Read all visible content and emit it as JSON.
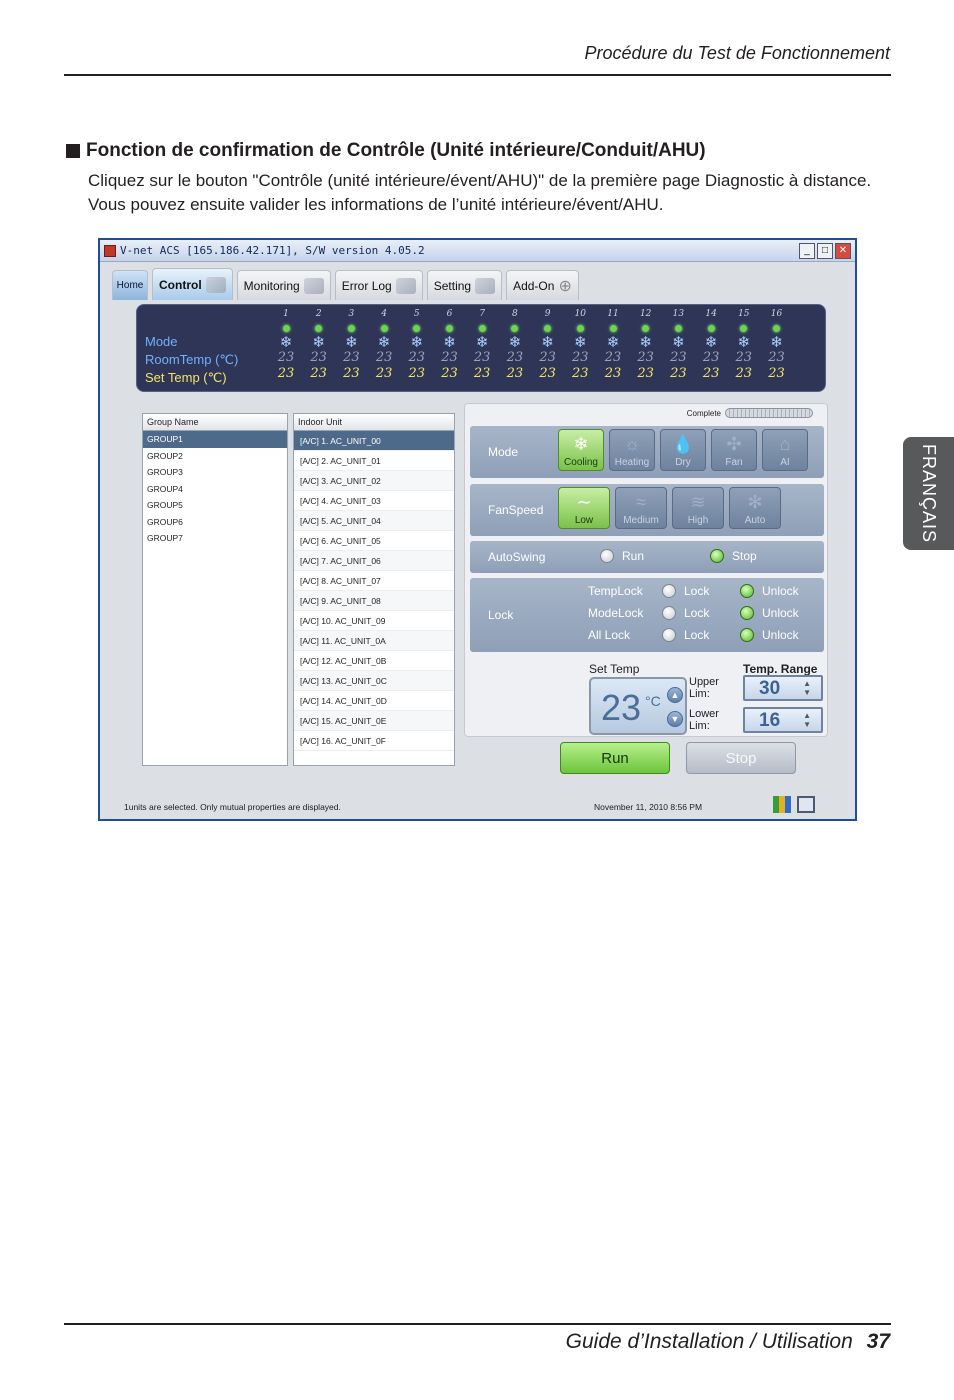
{
  "page": {
    "running_head": "Procédure du Test de Fonctionnement",
    "section_title": "Fonction de confirmation de Contrôle (Unité intérieure/Conduit/AHU)",
    "body_text": "Cliquez sur le bouton \"Contrôle (unité intérieure/évent/AHU)\" de la première page Diagnostic à distance. Vous pouvez ensuite valider les informations de l’unité intérieure/évent/AHU.",
    "side_tab": "FRANÇAIS",
    "footer_title": "Guide d’Installation / Utilisation",
    "page_number": "37"
  },
  "app": {
    "title": "V-net ACS [165.186.42.171],  S/W version 4.05.2",
    "tabs": [
      "Home",
      "Control",
      "Monitoring",
      "Error Log",
      "Setting",
      "Add-On"
    ],
    "status_labels": {
      "mode": "Mode",
      "room_temp": "RoomTemp (℃)",
      "set_temp": "Set Temp   (℃)"
    },
    "units": [
      {
        "n": "1",
        "rt": "23",
        "st": "23"
      },
      {
        "n": "2",
        "rt": "23",
        "st": "23"
      },
      {
        "n": "3",
        "rt": "23",
        "st": "23"
      },
      {
        "n": "4",
        "rt": "23",
        "st": "23"
      },
      {
        "n": "5",
        "rt": "23",
        "st": "23"
      },
      {
        "n": "6",
        "rt": "23",
        "st": "23"
      },
      {
        "n": "7",
        "rt": "23",
        "st": "23"
      },
      {
        "n": "8",
        "rt": "23",
        "st": "23"
      },
      {
        "n": "9",
        "rt": "23",
        "st": "23"
      },
      {
        "n": "10",
        "rt": "23",
        "st": "23"
      },
      {
        "n": "11",
        "rt": "23",
        "st": "23"
      },
      {
        "n": "12",
        "rt": "23",
        "st": "23"
      },
      {
        "n": "13",
        "rt": "23",
        "st": "23"
      },
      {
        "n": "14",
        "rt": "23",
        "st": "23"
      },
      {
        "n": "15",
        "rt": "23",
        "st": "23"
      },
      {
        "n": "16",
        "rt": "23",
        "st": "23"
      }
    ],
    "group_list": {
      "header": "Group Name",
      "items": [
        "GROUP1",
        "GROUP2",
        "GROUP3",
        "GROUP4",
        "GROUP5",
        "GROUP6",
        "GROUP7"
      ],
      "selected": 0
    },
    "unit_list": {
      "header": "Indoor Unit",
      "items": [
        "[A/C]  1. AC_UNIT_00",
        "[A/C]  2. AC_UNIT_01",
        "[A/C]  3. AC_UNIT_02",
        "[A/C]  4. AC_UNIT_03",
        "[A/C]  5. AC_UNIT_04",
        "[A/C]  6. AC_UNIT_05",
        "[A/C]  7. AC_UNIT_06",
        "[A/C]  8. AC_UNIT_07",
        "[A/C]  9. AC_UNIT_08",
        "[A/C]  10. AC_UNIT_09",
        "[A/C]  11. AC_UNIT_0A",
        "[A/C]  12. AC_UNIT_0B",
        "[A/C]  13. AC_UNIT_0C",
        "[A/C]  14. AC_UNIT_0D",
        "[A/C]  15. AC_UNIT_0E",
        "[A/C]  16. AC_UNIT_0F"
      ],
      "selected": 0
    },
    "control": {
      "complete_label": "Complete",
      "mode_label": "Mode",
      "modes": [
        {
          "label": "Cooling",
          "icon": "❄",
          "active": true
        },
        {
          "label": "Heating",
          "icon": "☼",
          "active": false
        },
        {
          "label": "Dry",
          "icon": "💧",
          "active": false
        },
        {
          "label": "Fan",
          "icon": "✣",
          "active": false
        },
        {
          "label": "AI",
          "icon": "⌂",
          "active": false
        }
      ],
      "fanspeed_label": "FanSpeed",
      "fanspeeds": [
        {
          "label": "Low",
          "icon": "∼",
          "active": true
        },
        {
          "label": "Medium",
          "icon": "≈",
          "active": false
        },
        {
          "label": "High",
          "icon": "≋",
          "active": false
        },
        {
          "label": "Auto",
          "icon": "✻",
          "active": false
        }
      ],
      "autoswing_label": "AutoSwing",
      "autoswing_run": "Run",
      "autoswing_stop": "Stop",
      "lock_label": "Lock",
      "locks": [
        {
          "name": "TempLock",
          "lock": "Lock",
          "unlock": "Unlock"
        },
        {
          "name": "ModeLock",
          "lock": "Lock",
          "unlock": "Unlock"
        },
        {
          "name": "All Lock",
          "lock": "Lock",
          "unlock": "Unlock"
        }
      ],
      "set_temp_label": "Set Temp",
      "set_temp_value": "23",
      "set_temp_unit": "°C",
      "temp_range_label": "Temp. Range",
      "upper_lim_label": "Upper Lim:",
      "upper_lim_value": "30",
      "lower_lim_label": "Lower Lim:",
      "lower_lim_value": "16",
      "run_label": "Run",
      "stop_label": "Stop"
    },
    "statusbar": {
      "message": "1units are selected. Only mutual properties are displayed.",
      "datetime": "November 11, 2010  8:56 PM"
    }
  }
}
